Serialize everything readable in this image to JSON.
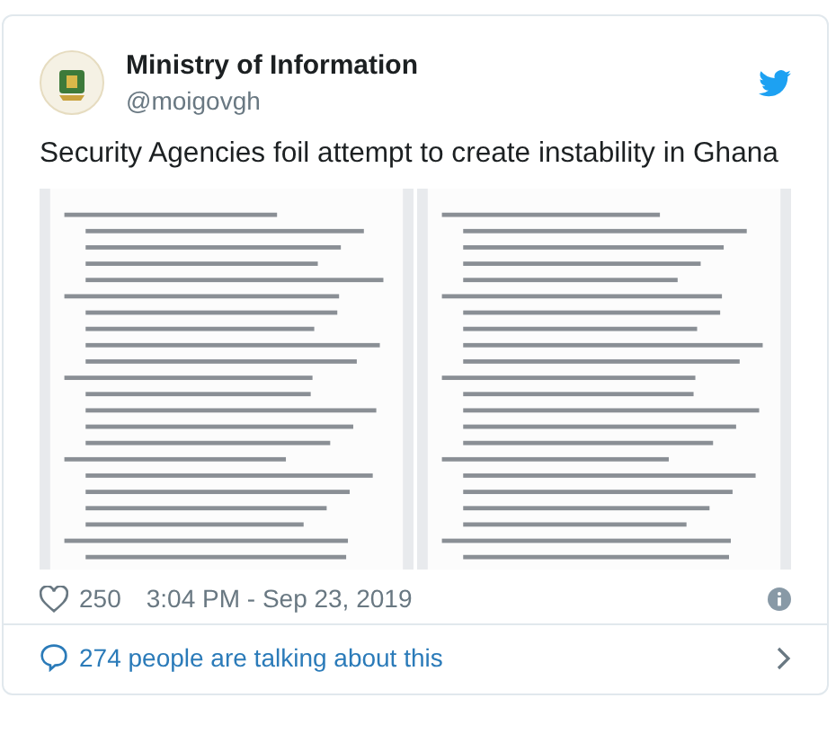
{
  "author": {
    "name": "Ministry of Information",
    "handle": "@moigovgh"
  },
  "tweet": {
    "text": "Security Agencies foil attempt to create instability in Ghana"
  },
  "footer": {
    "likes": "250",
    "timestamp": "3:04 PM - Sep 23, 2019"
  },
  "conversation": {
    "text": "274 people are talking about this"
  }
}
